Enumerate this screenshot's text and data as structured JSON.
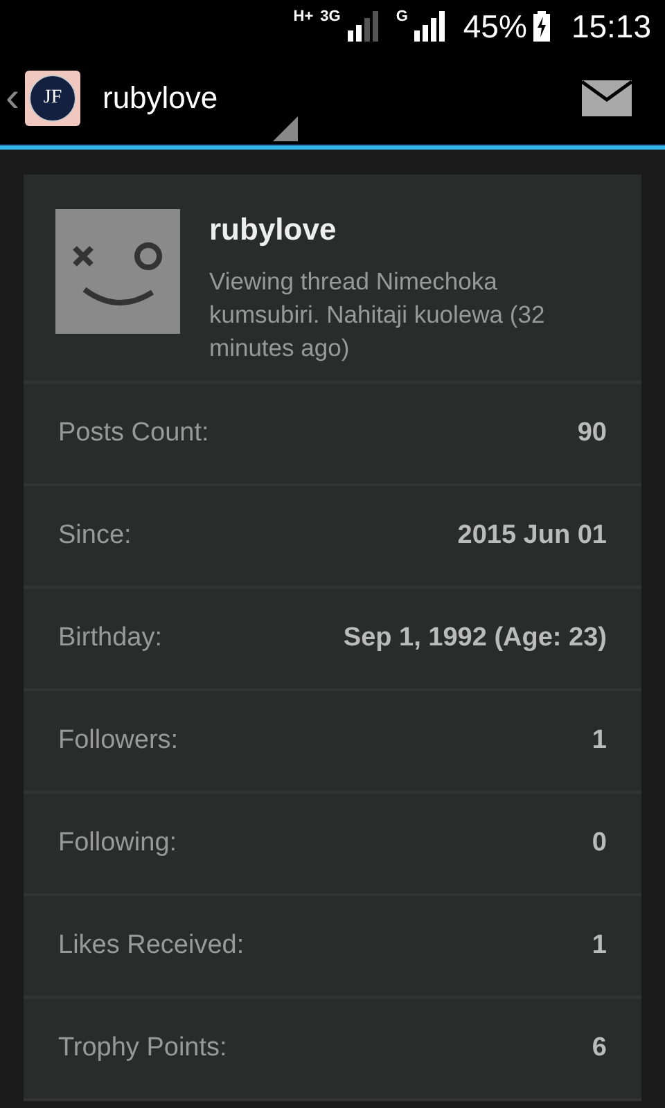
{
  "status_bar": {
    "network_labels": [
      "H+",
      "3G",
      "G"
    ],
    "battery": "45%",
    "time": "15:13"
  },
  "action_bar": {
    "back": "‹",
    "logo_text": "JF",
    "title": "rubylove"
  },
  "profile": {
    "username": "rubylove",
    "activity": "Viewing thread Nimechoka kumsubiri. Nahitaji  kuolewa (32 minutes ago)"
  },
  "stats": [
    {
      "label": "Posts Count:",
      "value": "90"
    },
    {
      "label": "Since:",
      "value": "2015 Jun 01"
    },
    {
      "label": "Birthday:",
      "value": "Sep 1, 1992 (Age: 23)"
    },
    {
      "label": "Followers:",
      "value": "1"
    },
    {
      "label": "Following:",
      "value": "0"
    },
    {
      "label": "Likes Received:",
      "value": "1"
    },
    {
      "label": "Trophy Points:",
      "value": "6"
    }
  ]
}
